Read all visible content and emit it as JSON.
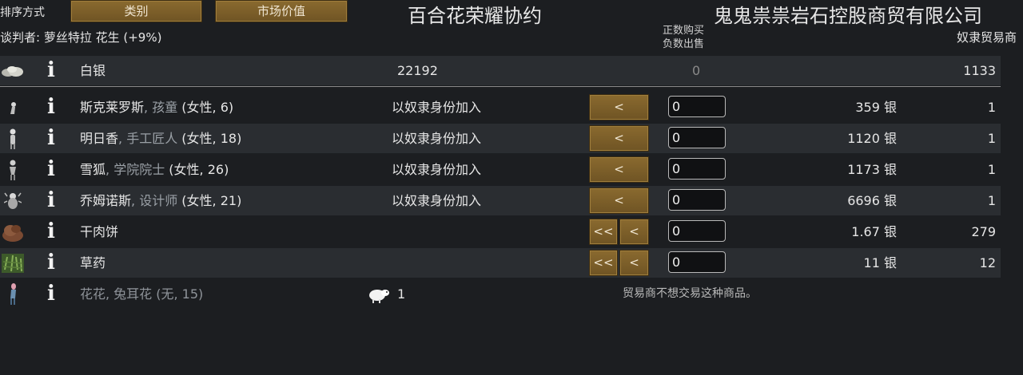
{
  "sort": {
    "label": "排序方式",
    "buttons": [
      "类别",
      "市场价值"
    ]
  },
  "headers": {
    "colony": "百合花荣耀协约",
    "trader": "鬼鬼祟祟岩石控股商贸有限公司",
    "negotiator": "谈判者: 萝丝特拉 花生 (+9%)",
    "note_line1": "正数购买",
    "note_line2": "负数出售",
    "trader_type": "奴隶贸易商"
  },
  "silver": {
    "name": "白银",
    "colony_count": "22192",
    "qty": "0",
    "trader_count": "1133"
  },
  "rows": [
    {
      "name": "斯克莱罗斯",
      "role": ", 孩童",
      "extra": " (女性, 6)",
      "action": "以奴隶身份加入",
      "btn_single": "<",
      "qty": "0",
      "price": "359 银",
      "stock": "1",
      "icon": "child-pawn-icon"
    },
    {
      "name": "明日香",
      "role": ", 手工匠人",
      "extra": " (女性, 18)",
      "action": "以奴隶身份加入",
      "btn_single": "<",
      "qty": "0",
      "price": "1120 银",
      "stock": "1",
      "icon": "pawn-icon"
    },
    {
      "name": "雪狐",
      "role": ", 学院院士",
      "extra": " (女性, 26)",
      "action": "以奴隶身份加入",
      "btn_single": "<",
      "qty": "0",
      "price": "1173 银",
      "stock": "1",
      "icon": "pawn-icon"
    },
    {
      "name": "乔姆诺斯",
      "role": ", 设计师",
      "extra": " (女性, 21)",
      "action": "以奴隶身份加入",
      "btn_single": "<",
      "qty": "0",
      "price": "6696 银",
      "stock": "1",
      "icon": "pawn-icon"
    },
    {
      "name": "干肉饼",
      "btn_double": "<<",
      "btn_single": "<",
      "qty": "0",
      "price": "1.67 银",
      "stock": "279",
      "icon": "pemmican-icon"
    },
    {
      "name": "草药",
      "btn_double": "<<",
      "btn_single": "<",
      "qty": "0",
      "price": "11 银",
      "stock": "12",
      "icon": "herbal-medicine-icon"
    }
  ],
  "untradeable": {
    "name": "花花, 兔耳花 (无, 15)",
    "count": "1",
    "notice": "贸易商不想交易这种商品。",
    "icon": "animal-icon"
  },
  "colors": {
    "button_gold": "#8a6a2f",
    "background": "#1c1e21",
    "row_shade": "#2a2d31"
  }
}
